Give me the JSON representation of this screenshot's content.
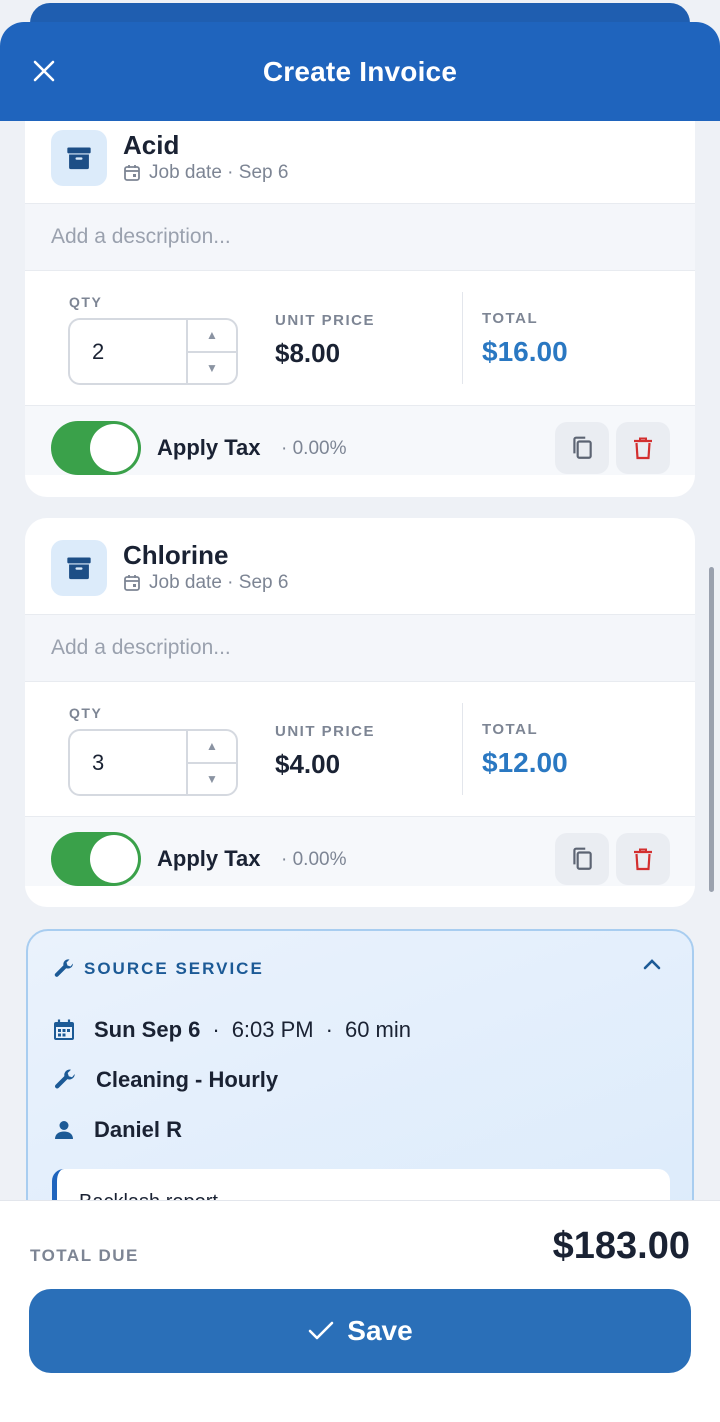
{
  "header": {
    "title": "Create Invoice"
  },
  "items": [
    {
      "name": "Acid",
      "job_date": "Job date · Sep 6",
      "description_placeholder": "Add a description...",
      "qty_label": "QTY",
      "qty": "2",
      "unit_price_label": "UNIT PRICE",
      "unit_price": "$8.00",
      "total_label": "TOTAL",
      "total": "$16.00",
      "tax_label": "Apply Tax",
      "tax_rate": "· 0.00%",
      "tax_enabled": true
    },
    {
      "name": "Chlorine",
      "job_date": "Job date · Sep 6",
      "description_placeholder": "Add a description...",
      "qty_label": "QTY",
      "qty": "3",
      "unit_price_label": "UNIT PRICE",
      "unit_price": "$4.00",
      "total_label": "TOTAL",
      "total": "$12.00",
      "tax_label": "Apply Tax",
      "tax_rate": "· 0.00%",
      "tax_enabled": true
    }
  ],
  "source_service": {
    "title": "SOURCE SERVICE",
    "date": "Sun Sep 6",
    "time": "6:03 PM",
    "duration": "60 min",
    "service": "Cleaning - Hourly",
    "person": "Daniel R",
    "note": "Backlash report..."
  },
  "footer": {
    "total_due_label": "TOTAL DUE",
    "total_due": "$183.00",
    "save_label": "Save"
  },
  "colors": {
    "header": "#1f64bd",
    "accent_total": "#2a78c2",
    "toggle_on": "#3aa14a",
    "delete": "#d32f2f",
    "save": "#2a6fb8"
  }
}
